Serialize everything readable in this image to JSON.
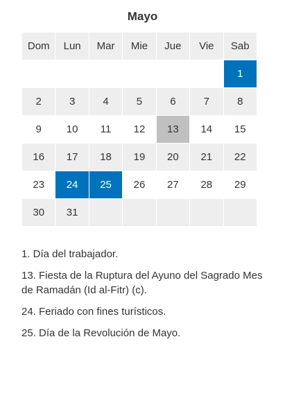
{
  "calendar": {
    "month": "Mayo",
    "weekdays": [
      "Dom",
      "Lun",
      "Mar",
      "Mie",
      "Jue",
      "Vie",
      "Sab"
    ],
    "weeks": [
      [
        "",
        "",
        "",
        "",
        "",
        "",
        "1"
      ],
      [
        "2",
        "3",
        "4",
        "5",
        "6",
        "7",
        "8"
      ],
      [
        "9",
        "10",
        "11",
        "12",
        "13",
        "14",
        "15"
      ],
      [
        "16",
        "17",
        "18",
        "19",
        "20",
        "21",
        "22"
      ],
      [
        "23",
        "24",
        "25",
        "26",
        "27",
        "28",
        "29"
      ],
      [
        "30",
        "31",
        "",
        "",
        "",
        "",
        ""
      ]
    ],
    "holidays_blue": [
      "1",
      "24",
      "25"
    ],
    "holidays_grey": [
      "13"
    ],
    "colors": {
      "holiday_blue": "#0072bb",
      "holiday_grey": "#c0c0c0",
      "row_grey": "#eeeeee"
    }
  },
  "notes": [
    "1. Día del trabajador.",
    "13. Fiesta de la Ruptura del Ayuno del Sagrado Mes de Ramadán (Id al-Fitr) (c).",
    "24. Feriado con fines turísticos.",
    "25. Día de la Revolución de Mayo."
  ]
}
